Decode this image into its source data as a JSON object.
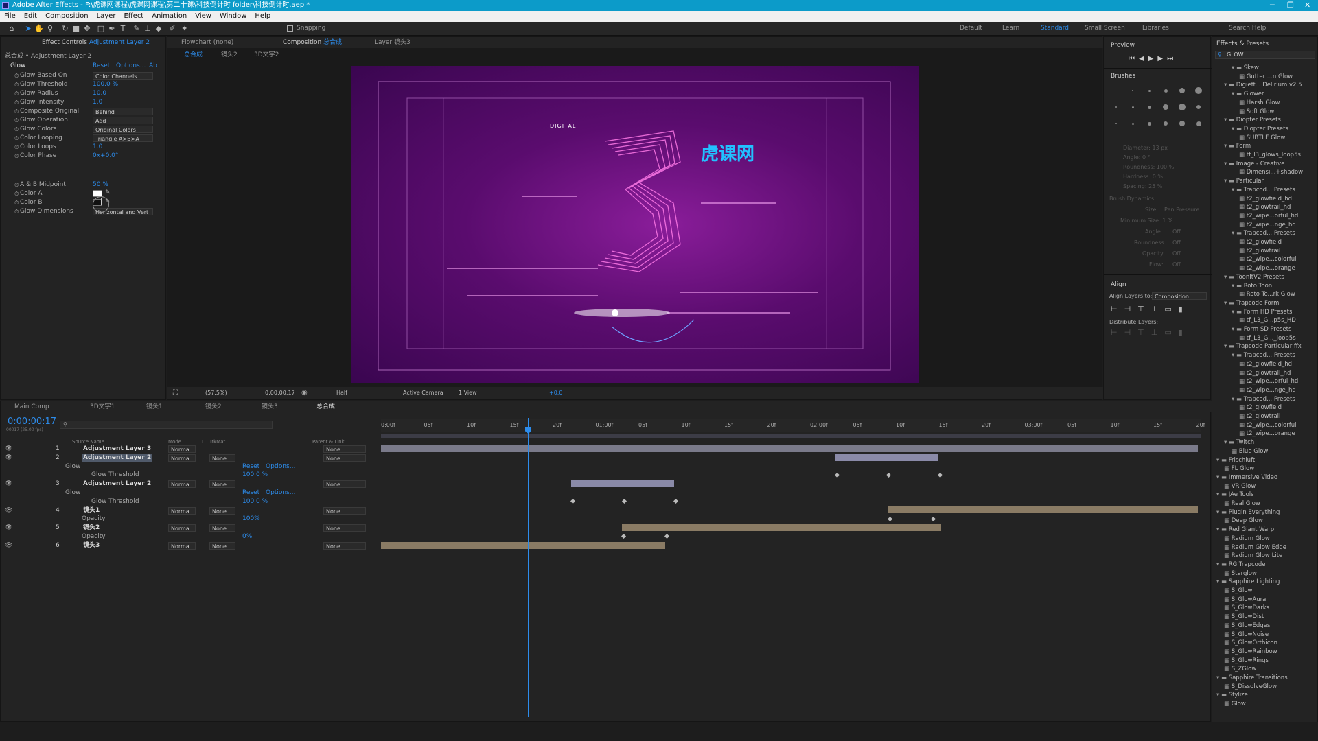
{
  "title_bar": "Adobe After Effects - F:\\虎课网课程\\虎课网课程\\第二十课\\科技倒计时 folder\\科技倒计时.aep *",
  "menu": [
    "File",
    "Edit",
    "Composition",
    "Layer",
    "Effect",
    "Animation",
    "View",
    "Window",
    "Help"
  ],
  "toolbar": {
    "snapping": "Snapping"
  },
  "workspaces": [
    "Default",
    "Learn",
    "Standard",
    "Small Screen",
    "Libraries"
  ],
  "search_help": "Search Help",
  "effect_controls": {
    "tab": "Effect Controls",
    "tab_layer": "Adjustment Layer 2",
    "header": "总合成 • Adjustment Layer 2",
    "effect_name": "Glow",
    "reset": "Reset",
    "options": "Options...",
    "about": "Ab",
    "props": [
      {
        "name": "Glow Based On",
        "dd": "Color Channels"
      },
      {
        "name": "Glow Threshold",
        "value": "100.0 %"
      },
      {
        "name": "Glow Radius",
        "value": "10.0"
      },
      {
        "name": "Glow Intensity",
        "value": "1.0"
      },
      {
        "name": "Composite Original",
        "dd": "Behind"
      },
      {
        "name": "Glow Operation",
        "dd": "Add"
      },
      {
        "name": "Glow Colors",
        "dd": "Original Colors"
      },
      {
        "name": "Color Looping",
        "dd": "Triangle A>B>A"
      },
      {
        "name": "Color Loops",
        "value": "1.0"
      },
      {
        "name": "Color Phase",
        "value": "0x+0.0°"
      },
      {
        "name": "A & B Midpoint",
        "value": "50 %"
      },
      {
        "name": "Color A",
        "swatch": "#ffffff"
      },
      {
        "name": "Color B",
        "swatch": "#111111"
      },
      {
        "name": "Glow Dimensions",
        "dd": "Horizontal and Vert"
      }
    ]
  },
  "flowchart_tab": "Flowchart (none)",
  "composition_tab": "Composition",
  "composition_tab_name": "总合成",
  "layer_tab": "Layer 镜头3",
  "breadcrumbs": [
    "总合成",
    "镜头2",
    "3D文字2"
  ],
  "viewer": {
    "zoom": "(57.5%)",
    "timecode": "0:00:00:17",
    "resolution": "Half",
    "camera": "Active Camera",
    "views": "1 View",
    "exposure": "+0.0",
    "canvas_digital": "DIGITAL",
    "canvas_brand": "虎课网"
  },
  "preview": {
    "title": "Preview"
  },
  "brushes": {
    "title": "Brushes",
    "diameter": "Diameter: 13 px",
    "angle": "Angle: 0 °",
    "roundness": "Roundness: 100 %",
    "hardness": "Hardness: 0 %",
    "spacing": "Spacing: 25 %",
    "dynamics": "Brush Dynamics",
    "size": "Size:",
    "size_val": "Pen Pressure",
    "min_size": "Minimum Size: 1 %",
    "b_angle": "Angle:",
    "b_round": "Roundness:",
    "opacity": "Opacity:",
    "flow": "Flow:",
    "off": "Off"
  },
  "align": {
    "title": "Align",
    "align_to": "Align Layers to:",
    "target": "Composition",
    "distribute": "Distribute Layers:"
  },
  "effects_presets": {
    "tab": "Effects & Presets",
    "search": "GLOW",
    "items": [
      {
        "t": "Skew",
        "d": 2,
        "f": 1
      },
      {
        "t": "Gutter ...n Glow",
        "d": 3
      },
      {
        "t": "Digieff... Delirium v2.5",
        "d": 1,
        "f": 1
      },
      {
        "t": "Glower",
        "d": 2,
        "f": 1
      },
      {
        "t": "Harsh Glow",
        "d": 3
      },
      {
        "t": "Soft Glow",
        "d": 3
      },
      {
        "t": "Diopter Presets",
        "d": 1,
        "f": 1
      },
      {
        "t": "Diopter Presets",
        "d": 2,
        "f": 1
      },
      {
        "t": "SUBTLE Glow",
        "d": 3
      },
      {
        "t": "Form",
        "d": 1,
        "f": 1
      },
      {
        "t": "tf_l3_glows_loop5s",
        "d": 3
      },
      {
        "t": "Image - Creative",
        "d": 1,
        "f": 1
      },
      {
        "t": "Dimensi...+shadow",
        "d": 3
      },
      {
        "t": "Particular",
        "d": 1,
        "f": 1
      },
      {
        "t": "Trapcod... Presets",
        "d": 2,
        "f": 1
      },
      {
        "t": "t2_glowfield_hd",
        "d": 3
      },
      {
        "t": "t2_glowtrail_hd",
        "d": 3
      },
      {
        "t": "t2_wipe...orful_hd",
        "d": 3
      },
      {
        "t": "t2_wipe...nge_hd",
        "d": 3
      },
      {
        "t": "Trapcod... Presets",
        "d": 2,
        "f": 1
      },
      {
        "t": "t2_glowfield",
        "d": 3
      },
      {
        "t": "t2_glowtrail",
        "d": 3
      },
      {
        "t": "t2_wipe...colorful",
        "d": 3
      },
      {
        "t": "t2_wipe...orange",
        "d": 3
      },
      {
        "t": "ToonItV2 Presets",
        "d": 1,
        "f": 1
      },
      {
        "t": "Roto Toon",
        "d": 2,
        "f": 1
      },
      {
        "t": "Roto To...rk Glow",
        "d": 3
      },
      {
        "t": "Trapcode Form",
        "d": 1,
        "f": 1
      },
      {
        "t": "Form HD Presets",
        "d": 2,
        "f": 1
      },
      {
        "t": "tf_L3_G...p5s_HD",
        "d": 3
      },
      {
        "t": "Form SD Presets",
        "d": 2,
        "f": 1
      },
      {
        "t": "tf_L3_G..._loop5s",
        "d": 3
      },
      {
        "t": "Trapcode Particular ffx",
        "d": 1,
        "f": 1
      },
      {
        "t": "Trapcod... Presets",
        "d": 2,
        "f": 1
      },
      {
        "t": "t2_glowfield_hd",
        "d": 3
      },
      {
        "t": "t2_glowtrail_hd",
        "d": 3
      },
      {
        "t": "t2_wipe...orful_hd",
        "d": 3
      },
      {
        "t": "t2_wipe...nge_hd",
        "d": 3
      },
      {
        "t": "Trapcod... Presets",
        "d": 2,
        "f": 1
      },
      {
        "t": "t2_glowfield",
        "d": 3
      },
      {
        "t": "t2_glowtrail",
        "d": 3
      },
      {
        "t": "t2_wipe...colorful",
        "d": 3
      },
      {
        "t": "t2_wipe...orange",
        "d": 3
      },
      {
        "t": "Twitch",
        "d": 1,
        "f": 1
      },
      {
        "t": "Blue Glow",
        "d": 2
      },
      {
        "t": "Frischluft",
        "d": 0,
        "f": 1
      },
      {
        "t": "FL Glow",
        "d": 1
      },
      {
        "t": "Immersive Video",
        "d": 0,
        "f": 1
      },
      {
        "t": "VR Glow",
        "d": 1
      },
      {
        "t": "JAe Tools",
        "d": 0,
        "f": 1
      },
      {
        "t": "Real Glow",
        "d": 1
      },
      {
        "t": "Plugin Everything",
        "d": 0,
        "f": 1
      },
      {
        "t": "Deep Glow",
        "d": 1
      },
      {
        "t": "Red Giant Warp",
        "d": 0,
        "f": 1
      },
      {
        "t": "Radium Glow",
        "d": 1
      },
      {
        "t": "Radium Glow Edge",
        "d": 1
      },
      {
        "t": "Radium Glow Lite",
        "d": 1
      },
      {
        "t": "RG Trapcode",
        "d": 0,
        "f": 1
      },
      {
        "t": "Starglow",
        "d": 1
      },
      {
        "t": "Sapphire Lighting",
        "d": 0,
        "f": 1
      },
      {
        "t": "S_Glow",
        "d": 1
      },
      {
        "t": "S_GlowAura",
        "d": 1
      },
      {
        "t": "S_GlowDarks",
        "d": 1
      },
      {
        "t": "S_GlowDist",
        "d": 1
      },
      {
        "t": "S_GlowEdges",
        "d": 1
      },
      {
        "t": "S_GlowNoise",
        "d": 1
      },
      {
        "t": "S_GlowOrthicon",
        "d": 1
      },
      {
        "t": "S_GlowRainbow",
        "d": 1
      },
      {
        "t": "S_GlowRings",
        "d": 1
      },
      {
        "t": "S_ZGlow",
        "d": 1
      },
      {
        "t": "Sapphire Transitions",
        "d": 0,
        "f": 1
      },
      {
        "t": "S_DissolveGlow",
        "d": 1
      },
      {
        "t": "Stylize",
        "d": 0,
        "f": 1
      },
      {
        "t": "Glow",
        "d": 1
      }
    ]
  },
  "timeline": {
    "tabs": [
      "Main Comp",
      "3D文字1",
      "镜头1",
      "镜头2",
      "镜头3",
      "总合成"
    ],
    "timecode": "0:00:00:17",
    "frames": "00017 (25.00 fps)",
    "col_source": "Source Name",
    "col_mode": "Mode",
    "col_t": "T",
    "col_trkmat": "TrkMat",
    "col_parent": "Parent & Link",
    "ruler": [
      "0:00f",
      "05f",
      "10f",
      "15f",
      "20f",
      "01:00f",
      "05f",
      "10f",
      "15f",
      "20f",
      "02:00f",
      "05f",
      "10f",
      "15f",
      "20f",
      "03:00f",
      "05f",
      "10f",
      "15f",
      "20f"
    ],
    "layers": [
      {
        "num": "1",
        "name": "Adjustment Layer 3",
        "mode": "Norma",
        "trk": "",
        "parent": "None"
      },
      {
        "num": "2",
        "name": "Adjustment Layer 2",
        "mode": "Norma",
        "trk": "None",
        "parent": "None"
      },
      {
        "num": "3",
        "name": "Adjustment Layer 2",
        "mode": "Norma",
        "trk": "None",
        "parent": "None"
      },
      {
        "num": "4",
        "name": "镜头1",
        "mode": "Norma",
        "trk": "None",
        "parent": "None"
      },
      {
        "num": "5",
        "name": "镜头2",
        "mode": "Norma",
        "trk": "None",
        "parent": "None"
      },
      {
        "num": "6",
        "name": "镜头3",
        "mode": "Norma",
        "trk": "None",
        "parent": "None"
      }
    ],
    "sub": {
      "fx": "fx",
      "glow": "Glow",
      "reset": "Reset",
      "options": "Options...",
      "threshold": "Glow Threshold",
      "threshold_val": "100.0 %",
      "opacity": "Opacity",
      "op1": "100%",
      "op2": "0%"
    }
  }
}
